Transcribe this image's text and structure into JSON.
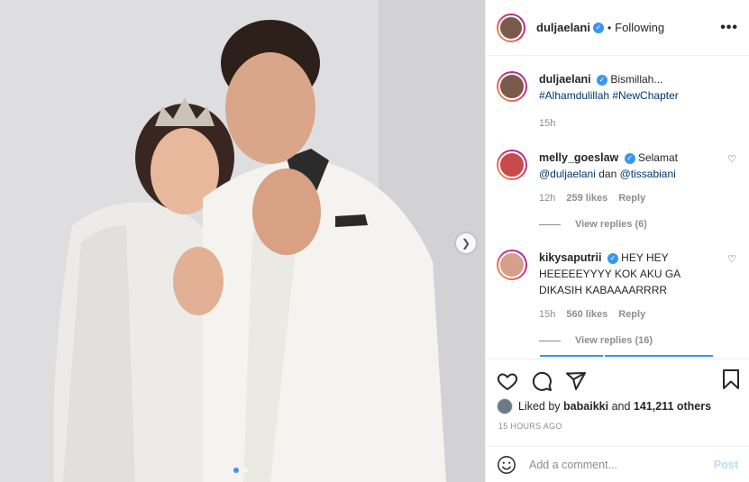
{
  "header": {
    "username": "duljaelani",
    "separator": "•",
    "follow_status": "Following",
    "more": "•••"
  },
  "caption": {
    "username": "duljaelani",
    "text": "Bismillah...",
    "hashtags": "#Alhamdulillah #NewChapter",
    "time": "15h"
  },
  "comments": [
    {
      "username": "melly_goeslaw",
      "text": "Selamat",
      "mention1": "@duljaelani",
      "between": "dan",
      "mention2": "@tissabiani",
      "time": "12h",
      "likes": "259 likes",
      "reply": "Reply",
      "view_replies": "View replies (6)"
    },
    {
      "username": "kikysaputrii",
      "text": "HEY HEY HEEEEEYYYY KOK AKU GA DIKASIH KABAAAARRRR",
      "time": "15h",
      "likes": "560 likes",
      "reply": "Reply",
      "view_replies": "View replies (16)"
    }
  ],
  "likes": {
    "prefix": "Liked by",
    "user": "babaikki",
    "and": "and",
    "count": "141,211 others"
  },
  "time_ago": "15 HOURS AGO",
  "add_comment": {
    "placeholder": "Add a comment...",
    "post_label": "Post"
  },
  "colors": {
    "verified": "#3897f0",
    "link": "#00376b",
    "muted": "#8e8e8e",
    "post_disabled": "#b2dffc"
  },
  "icons": {
    "next": "chevron-right-icon",
    "like": "heart-icon",
    "comment": "comment-icon",
    "share": "paper-plane-icon",
    "save": "bookmark-icon",
    "emoji": "smiley-icon"
  }
}
